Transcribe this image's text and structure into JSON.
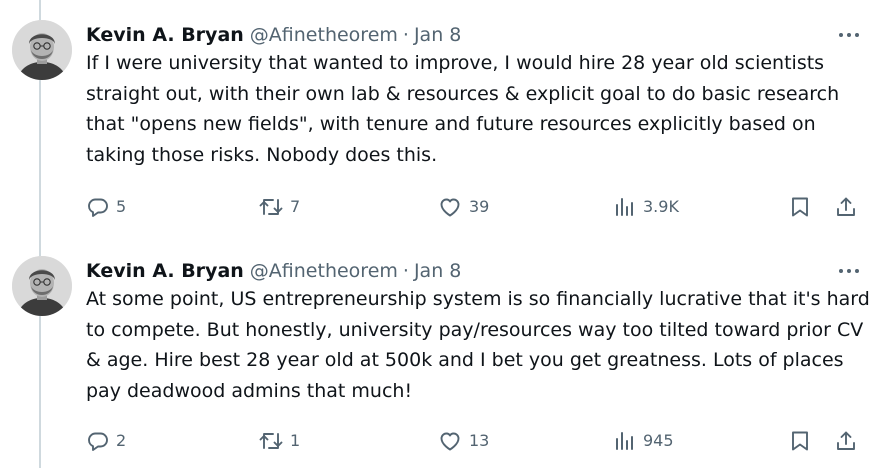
{
  "tweets": [
    {
      "author": {
        "name": "Kevin A. Bryan",
        "handle": "@Afinetheorem",
        "separator": "·",
        "date": "Jan 8"
      },
      "text": "If I were university that wanted to improve, I would hire 28 year old scientists straight out, with their own lab & resources & explicit goal to do basic research that \"opens new fields\", with tenure and future resources explicitly based on taking those risks. Nobody does this.",
      "stats": {
        "replies": "5",
        "reposts": "7",
        "likes": "39",
        "views": "3.9K"
      }
    },
    {
      "author": {
        "name": "Kevin A. Bryan",
        "handle": "@Afinetheorem",
        "separator": "·",
        "date": "Jan 8"
      },
      "text": "At some point, US entrepreneurship system is so financially lucrative that it's hard to compete. But honestly, university pay/resources way too tilted toward prior CV & age. Hire best 28 year old at 500k and I bet you get greatness. Lots of places pay deadwood admins that much!",
      "stats": {
        "replies": "2",
        "reposts": "1",
        "likes": "13",
        "views": "945"
      }
    }
  ],
  "colors": {
    "text": "#0f1419",
    "secondary": "#536471",
    "thread_line": "#cfd9de"
  },
  "icons": [
    "reply-icon",
    "repost-icon",
    "like-icon",
    "views-icon",
    "bookmark-icon",
    "share-icon",
    "more-icon",
    "avatar"
  ]
}
